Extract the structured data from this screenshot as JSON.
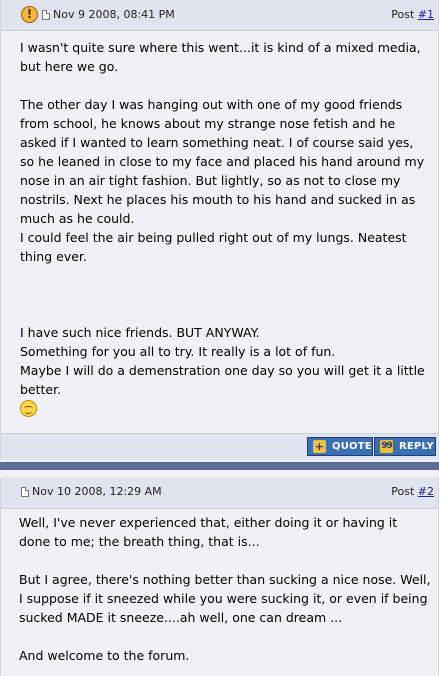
{
  "posts": [
    {
      "date": "Nov 9 2008, 08:41 PM",
      "post_label": "Post ",
      "post_link": "#1",
      "paragraphs_a": [
        "I wasn't quite sure where this went...it is kind of a mixed media, but here we go."
      ],
      "paragraphs_b": [
        "The other day I was hanging out with one of my good friends from school, he knows about my strange nose fetish and he asked if I wanted to learn something neat. I of course said yes, so he leaned in close to my face and placed his hand around my nose in an air tight fashion. But lightly, so as not to close my nostrils. Next he places his mouth to his hand and sucked in as much as he could.",
        "I could feel the air being pulled right out of my lungs. Neatest thing ever."
      ],
      "paragraphs_c": [
        "I have such nice friends. BUT ANYWAY.",
        "Something for you all to try. It really is a lot of fun.",
        "Maybe I will do a demenstration one day so you will get it a little better."
      ],
      "quote_label": "QUOTE",
      "reply_label": "REPLY",
      "warn_icon_glyph": "!"
    },
    {
      "date": "Nov 10 2008, 12:29 AM",
      "post_label": "Post ",
      "post_link": "#2",
      "paragraphs_a": [
        "Well, I've never experienced that, either doing it or having it done to me; the breath thing, that is..."
      ],
      "paragraphs_b": [
        "But I agree, there's nothing better than sucking a nice nose. Well, I suppose if it sneezed while you were sucking it, or even if being sucked MADE it sneeze....ah well, one can dream ..."
      ],
      "paragraphs_c": [
        "And welcome to the forum."
      ]
    }
  ],
  "colors": {
    "header_bg": "#dfe4ee",
    "body_bg": "#eff1f6",
    "separator": "#5b6f96",
    "button_bg": "#3a6fb4",
    "link": "#22229c"
  }
}
